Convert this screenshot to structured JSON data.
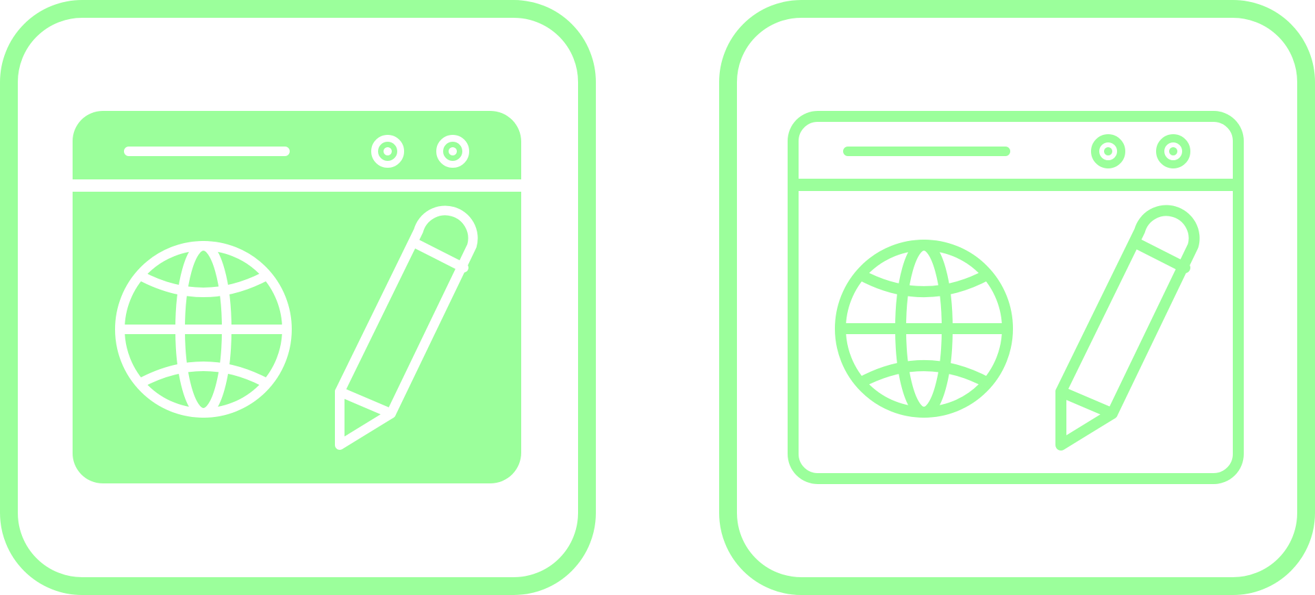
{
  "icons": [
    {
      "name": "web-design-icon",
      "style": "glyph",
      "symbol": "browser-window-with-globe-and-pencil"
    },
    {
      "name": "web-design-icon",
      "style": "outline",
      "symbol": "browser-window-with-globe-and-pencil"
    }
  ],
  "colors": {
    "accent": "#9BFF9B",
    "background": "#FFFFFF"
  }
}
